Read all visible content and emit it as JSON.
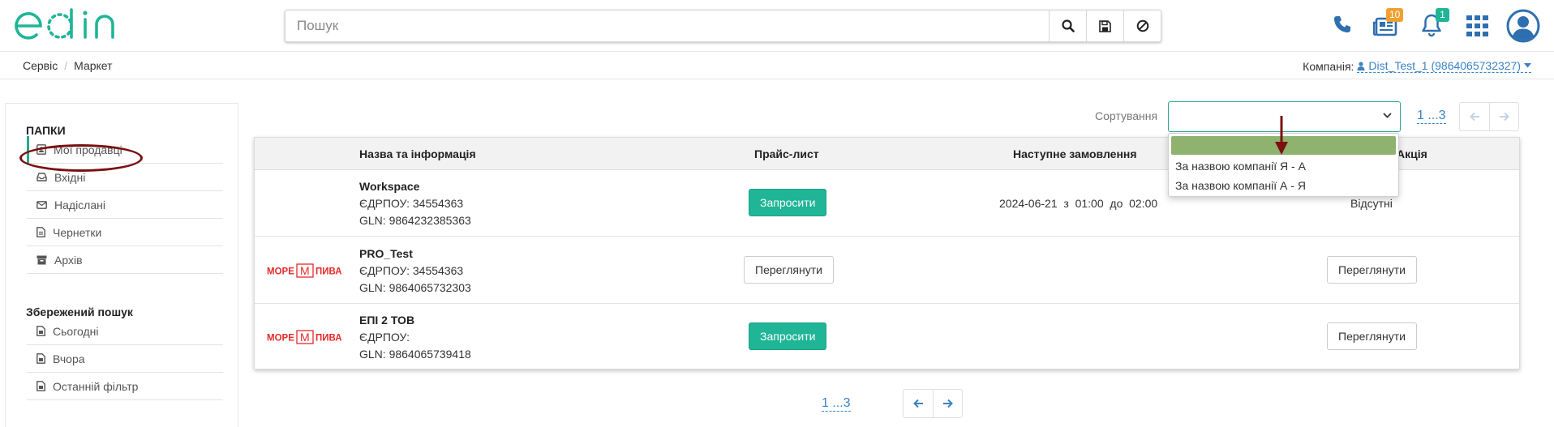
{
  "header": {
    "logo_text": "edin",
    "search_placeholder": "Пошук",
    "icons": [
      "phone-icon",
      "documents-icon",
      "bell-icon",
      "apps-grid-icon",
      "user-avatar-icon"
    ],
    "documents_badge": "10",
    "notifications_badge": "1",
    "accent_color": "#2aa889"
  },
  "breadcrumb": {
    "items": [
      "Сервіс",
      "Маркет"
    ],
    "separator": "/"
  },
  "company": {
    "label": "Компанія:",
    "value": "Dist_Test_1 (9864065732327)"
  },
  "sidebar": {
    "folders_title": "ПАПКИ",
    "folders": [
      {
        "label": "Мої продавці",
        "icon": "contact-card-icon",
        "active": true
      },
      {
        "label": "Вхідні",
        "icon": "inbox-icon"
      },
      {
        "label": "Надіслані",
        "icon": "envelope-icon"
      },
      {
        "label": "Чернетки",
        "icon": "draft-doc-icon"
      },
      {
        "label": "Архів",
        "icon": "archive-icon"
      }
    ],
    "saved_title": "Збережений пошук",
    "saved": [
      {
        "label": "Сьогодні",
        "icon": "saved-filter-icon"
      },
      {
        "label": "Вчора",
        "icon": "saved-filter-icon"
      },
      {
        "label": "Останній фільтр",
        "icon": "saved-filter-icon"
      }
    ]
  },
  "sort": {
    "label": "Сортування",
    "selected_value": "",
    "options": [
      "",
      "За назвою компанії Я - А",
      "За назвою компанії А - Я"
    ]
  },
  "pagination": {
    "text": "1 ...3"
  },
  "table": {
    "columns": [
      "Назва та інформація",
      "Прайс-лист",
      "Наступне замовлення",
      "Акція"
    ],
    "rows": [
      {
        "logo": "",
        "name": "Workspace",
        "edrpou": "ЄДРПОУ: 34554363",
        "gln": "GLN: 9864232385363",
        "price_action": "Запросити",
        "next_order": "2024-06-21  з  01:00  до  02:00",
        "promo": "Відсутні"
      },
      {
        "logo": "МОРЕ|М|ПИВА",
        "name": "PRO_Test",
        "edrpou": "ЄДРПОУ: 34554363",
        "gln": "GLN: 9864065732303",
        "price_action": "Переглянути",
        "next_order": "",
        "promo": "Переглянути"
      },
      {
        "logo": "МОРЕ|М|ПИВА",
        "name": "ЕПІ 2 ТОВ",
        "edrpou": "ЄДРПОУ:",
        "gln": "GLN: 9864065739418",
        "price_action": "Запросити",
        "next_order": "",
        "promo": "Переглянути"
      }
    ]
  },
  "logos": {
    "more_left": "МОРЕ",
    "more_mid": "М",
    "more_right": "ПИВА",
    "brand_color": "#e52a2a"
  }
}
